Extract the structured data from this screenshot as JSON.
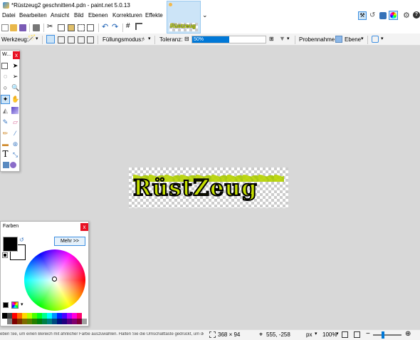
{
  "window": {
    "title": "*Rüstzeug2 geschnitten4.pdn - paint.net 5.0.13",
    "minimize": "—",
    "maximize": "☐",
    "close": "✕"
  },
  "menu": [
    "Datei",
    "Bearbeiten",
    "Ansicht",
    "Bild",
    "Ebenen",
    "Korrekturen",
    "Effekte"
  ],
  "tab": {
    "thumb_text": "Rüstzeug",
    "dropdown": "⌄"
  },
  "tool_options": {
    "tool_label": "Werkzeug:",
    "fill_mode_label": "Füllungsmodus:",
    "tolerance_label": "Toleranz:",
    "tolerance_value": "50%",
    "tolerance_percent": 50,
    "sampling_label": "Probennahme:",
    "sampling_value": "Ebene"
  },
  "tools_window": {
    "title": "W...",
    "close": "x"
  },
  "colors_window": {
    "title": "Farben",
    "close": "x",
    "more_button": "Mehr >>"
  },
  "canvas": {
    "text": "RüstZeug"
  },
  "status": {
    "hint": "eben Sie, um einen Bereich mit ähnlicher Farbe auszuwählen. Halten Sie die Umschalttaste gedrückt, um den globalen Modus zu aktivieren.",
    "size": "368 × 94",
    "position": "555, -258",
    "unit": "px",
    "zoom": "100%"
  },
  "colors": {
    "accent": "#0078d7",
    "close_red": "#e81123",
    "primary": "#000000",
    "secondary": "#ffffff",
    "text_fill": "#c6e000",
    "flame": "#aacc00"
  }
}
